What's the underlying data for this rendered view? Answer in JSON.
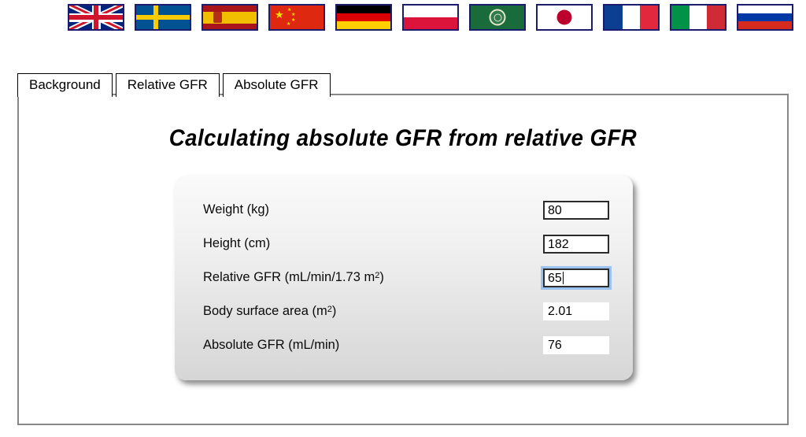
{
  "flags": [
    {
      "name": "united-kingdom",
      "label": "English",
      "class": "f-uk"
    },
    {
      "name": "sweden",
      "label": "Svenska",
      "class": "f-se"
    },
    {
      "name": "spain",
      "label": "Espanol",
      "class": "f-es"
    },
    {
      "name": "china",
      "label": "Chinese",
      "class": "f-cn"
    },
    {
      "name": "germany",
      "label": "Deutsch",
      "class": "f-de"
    },
    {
      "name": "poland",
      "label": "Polski",
      "class": "f-pl"
    },
    {
      "name": "arab-league",
      "label": "Arabic",
      "class": "f-ar"
    },
    {
      "name": "japan",
      "label": "Japanese",
      "class": "f-jp"
    },
    {
      "name": "france",
      "label": "Francais",
      "class": "f-fr"
    },
    {
      "name": "italy",
      "label": "Italiano",
      "class": "f-it"
    },
    {
      "name": "russia",
      "label": "Russian",
      "class": "f-ru"
    }
  ],
  "tabs": [
    {
      "id": "background",
      "label": "Background",
      "selected": false
    },
    {
      "id": "relative-gfr",
      "label": "Relative GFR",
      "selected": false
    },
    {
      "id": "absolute-gfr",
      "label": "Absolute GFR",
      "selected": true
    }
  ],
  "page": {
    "title": "Calculating absolute GFR from relative GFR"
  },
  "form": {
    "rows": [
      {
        "id": "weight",
        "label_text": "Weight (kg)",
        "label_main": "Weight (kg)",
        "sup": "",
        "label_tail": "",
        "value": "80",
        "editable": true,
        "focused": false
      },
      {
        "id": "height",
        "label_text": "Height (cm)",
        "label_main": "Height (cm)",
        "sup": "",
        "label_tail": "",
        "value": "182",
        "editable": true,
        "focused": false
      },
      {
        "id": "relative-gfr",
        "label_text": "Relative GFR (mL/min/1.73 m2)",
        "label_main": "Relative GFR (mL/min/1.73 m",
        "sup": "2",
        "label_tail": ")",
        "value": "65",
        "editable": true,
        "focused": true
      },
      {
        "id": "body-surface-area",
        "label_text": "Body surface area (m2)",
        "label_main": "Body surface area (m",
        "sup": "2",
        "label_tail": ")",
        "value": "2.01",
        "editable": false,
        "focused": false
      },
      {
        "id": "absolute-gfr",
        "label_text": "Absolute GFR (mL/min)",
        "label_main": "Absolute GFR (mL/min)",
        "sup": "",
        "label_tail": "",
        "value": "76",
        "editable": false,
        "focused": false
      }
    ]
  },
  "colors": {
    "frame_border": "#878787",
    "panel_top": "#fafafa",
    "panel_bottom": "#d6d6d6",
    "focus_ring": "#82b4f0",
    "field_border": "#2b2b2b"
  }
}
